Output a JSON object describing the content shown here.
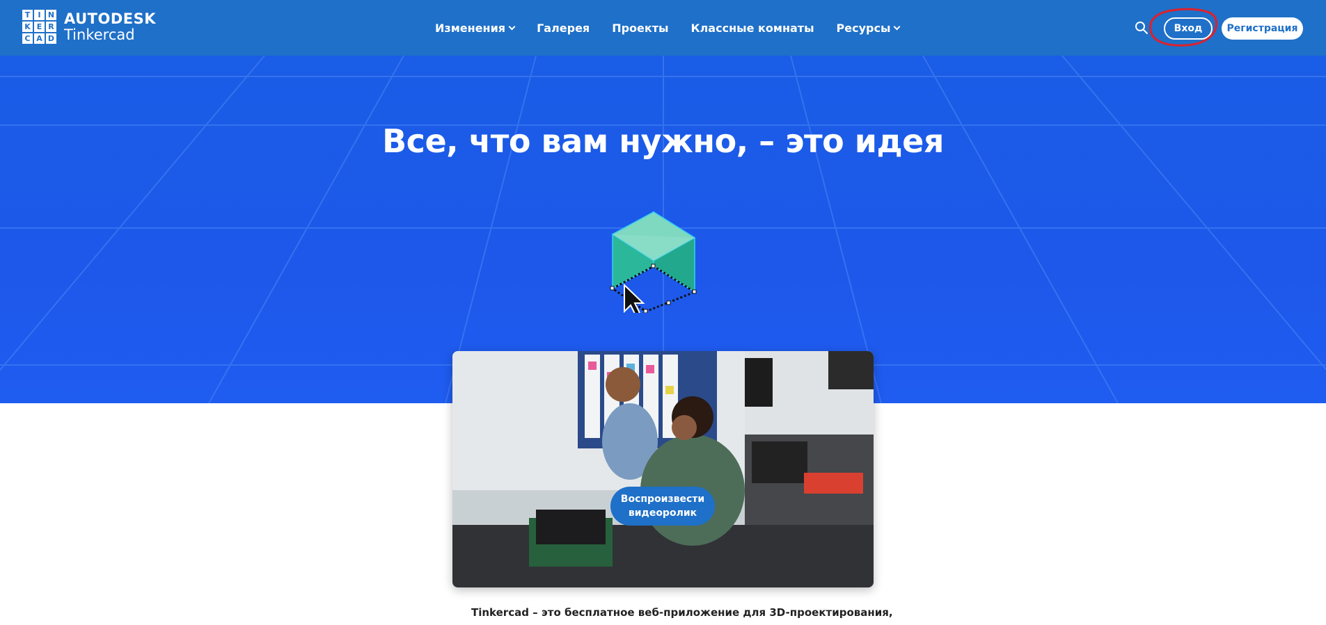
{
  "header": {
    "logo_letters": [
      "T",
      "I",
      "N",
      "K",
      "E",
      "R",
      "C",
      "A",
      "D"
    ],
    "brand": "AUTODESK",
    "product": "Tinkercad",
    "nav": [
      {
        "label": "Изменения",
        "has_dropdown": true
      },
      {
        "label": "Галерея",
        "has_dropdown": false
      },
      {
        "label": "Проекты",
        "has_dropdown": false
      },
      {
        "label": "Классные комнаты",
        "has_dropdown": false
      },
      {
        "label": "Ресурсы",
        "has_dropdown": true
      }
    ],
    "login_label": "Вход",
    "signup_label": "Регистрация",
    "search_icon": "search-icon"
  },
  "hero": {
    "title": "Все, что вам нужно, – это идея"
  },
  "video": {
    "play_label_line1": "Воспроизвести",
    "play_label_line2": "видеоролик"
  },
  "intro": {
    "text": "Tinkercad – это бесплатное веб-приложение для 3D-проектирования,"
  },
  "colors": {
    "header_bg": "#1f70c8",
    "hero_bg": "#1d58ea",
    "cube_face": "#2bb89a",
    "highlight": "#e0202a"
  }
}
